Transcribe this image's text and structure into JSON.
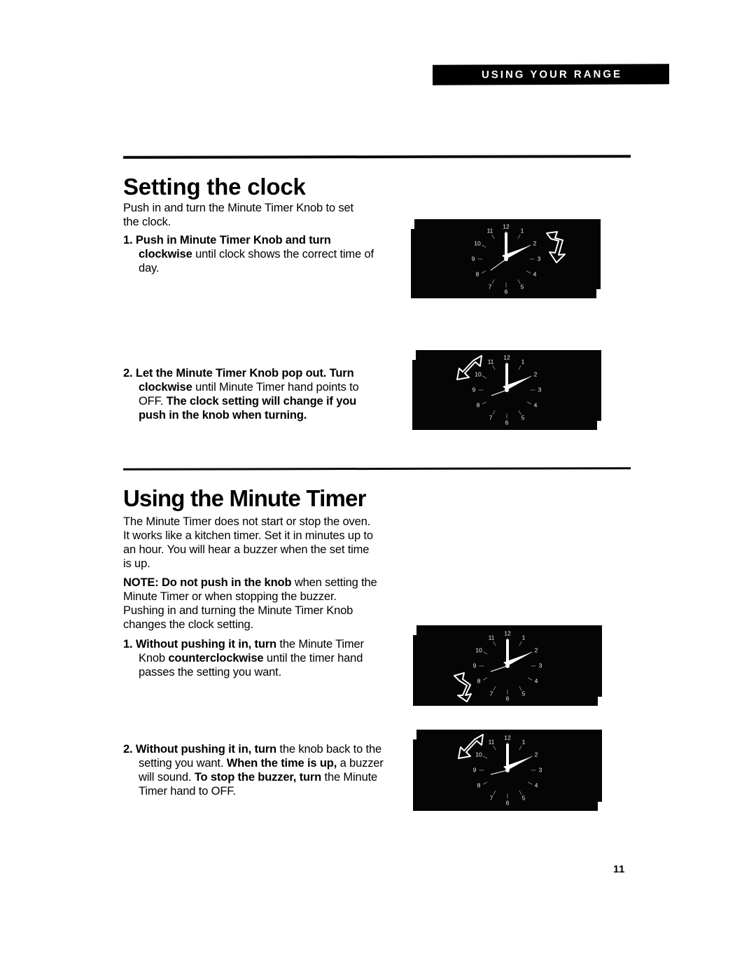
{
  "banner": {
    "text": "USING YOUR RANGE"
  },
  "sections": [
    {
      "id": "setting-the-clock",
      "title": "Setting the clock",
      "intro": "Push in and turn the Minute Timer Knob to set the clock.",
      "steps": [
        {
          "number": "1.",
          "runs": [
            {
              "text": "Push in Minute Timer Knob and turn clockwise ",
              "bold": true
            },
            {
              "text": "until clock shows the correct time of day.",
              "bold": false
            }
          ]
        },
        {
          "number": "2.",
          "runs": [
            {
              "text": "Let the Minute Timer Knob pop out. Turn clockwise ",
              "bold": true
            },
            {
              "text": "until Minute Timer hand points to OFF. ",
              "bold": false
            },
            {
              "text": "The clock setting will change if you push in the knob when turning.",
              "bold": true
            }
          ]
        }
      ]
    },
    {
      "id": "using-the-minute-timer",
      "title": "Using the Minute Timer",
      "intro": "The Minute Timer does not start or stop the oven. It works like a kitchen timer. Set it in minutes up to an hour. You will hear a buzzer when the set time is up.",
      "note": {
        "runs": [
          {
            "text": "NOTE: Do not push in the knob ",
            "bold": true
          },
          {
            "text": "when setting the Minute Timer or when stopping the buzzer. Pushing in and turning the Minute Timer Knob changes the clock setting.",
            "bold": false
          }
        ]
      },
      "steps": [
        {
          "number": "1.",
          "runs": [
            {
              "text": "Without pushing it in, turn ",
              "bold": true
            },
            {
              "text": "the Minute Timer Knob ",
              "bold": false
            },
            {
              "text": "counterclockwise ",
              "bold": true
            },
            {
              "text": "until the timer hand passes the setting you want.",
              "bold": false
            }
          ]
        },
        {
          "number": "2.",
          "runs": [
            {
              "text": "Without pushing it in, turn ",
              "bold": true
            },
            {
              "text": "the knob back to the setting you want. ",
              "bold": false
            },
            {
              "text": "When the time is up, ",
              "bold": true
            },
            {
              "text": "a buzzer will sound. ",
              "bold": false
            },
            {
              "text": "To stop the buzzer, turn ",
              "bold": true
            },
            {
              "text": "the Minute Timer hand to OFF.",
              "bold": false
            }
          ]
        }
      ]
    }
  ],
  "illustrations": [
    {
      "id": "clock-step-1",
      "numerals": [
        "12",
        "1",
        "2",
        "3",
        "4",
        "5",
        "6",
        "7",
        "8",
        "9",
        "10",
        "11"
      ],
      "hour_hand": "2",
      "minute_hand": "12",
      "arrow_direction": "clockwise",
      "arrow_position": "upper-right"
    },
    {
      "id": "clock-step-2",
      "numerals": [
        "12",
        "1",
        "2",
        "3",
        "4",
        "5",
        "6",
        "7",
        "8",
        "9",
        "10",
        "11"
      ],
      "hour_hand": "2",
      "minute_hand": "12",
      "arrow_direction": "clockwise",
      "arrow_position": "upper-left"
    },
    {
      "id": "clock-timer-step-1",
      "numerals": [
        "12",
        "1",
        "2",
        "3",
        "4",
        "5",
        "6",
        "7",
        "8",
        "9",
        "10",
        "11"
      ],
      "hour_hand": "2",
      "minute_hand": "12",
      "arrow_direction": "counterclockwise",
      "arrow_position": "lower-left"
    },
    {
      "id": "clock-timer-step-2",
      "numerals": [
        "12",
        "1",
        "2",
        "3",
        "4",
        "5",
        "6",
        "7",
        "8",
        "9",
        "10",
        "11"
      ],
      "hour_hand": "2",
      "minute_hand": "12",
      "arrow_direction": "clockwise",
      "arrow_position": "upper-left"
    }
  ],
  "folio": "11",
  "colors": {
    "ink": "#000000",
    "paper": "#ffffff",
    "panel": "#050505"
  }
}
